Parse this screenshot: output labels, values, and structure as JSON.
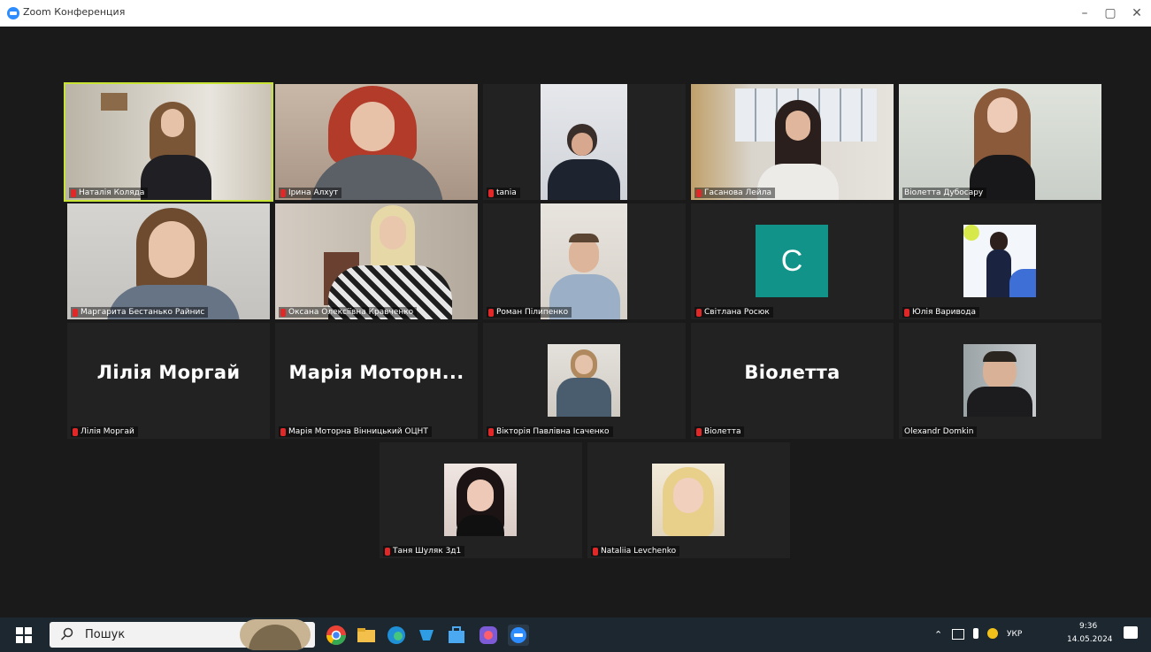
{
  "window": {
    "title": "Zoom Конференция",
    "minimize": "–",
    "maximize": "▢",
    "close": "✕"
  },
  "participants": {
    "row1": [
      "Наталія Коляда",
      "Ірина Алхут",
      "tania",
      "Гасанова Лейла",
      "Віолетта Дубосару"
    ],
    "row2": [
      "Маргарита Бестанько Райнис",
      "Оксана Олексіївна Кравченко",
      "Роман Пілипенко",
      "Світлана Росюк",
      "Юлія Варивода"
    ],
    "row3": [
      "Лілія Моргай",
      "Марія Моторна Вінницький ОЦНТ",
      "Вікторія Павлівна Ісаченко",
      "Віолетта",
      "Olexandr Domkin"
    ],
    "row4": [
      "Таня Шуляк 3д1",
      "Nataliia Levchenko"
    ],
    "big_names": [
      "Лілія Моргай",
      "Марія Моторн...",
      "Віолетта"
    ],
    "avatar_letter": "C"
  },
  "taskbar": {
    "search_placeholder": "Пошук",
    "lang": "УКР",
    "time": "9:36",
    "date": "14.05.2024"
  },
  "colors": {
    "active_border": "#c7e336",
    "avatar": "#12938a",
    "mic_muted": "#e02828"
  }
}
